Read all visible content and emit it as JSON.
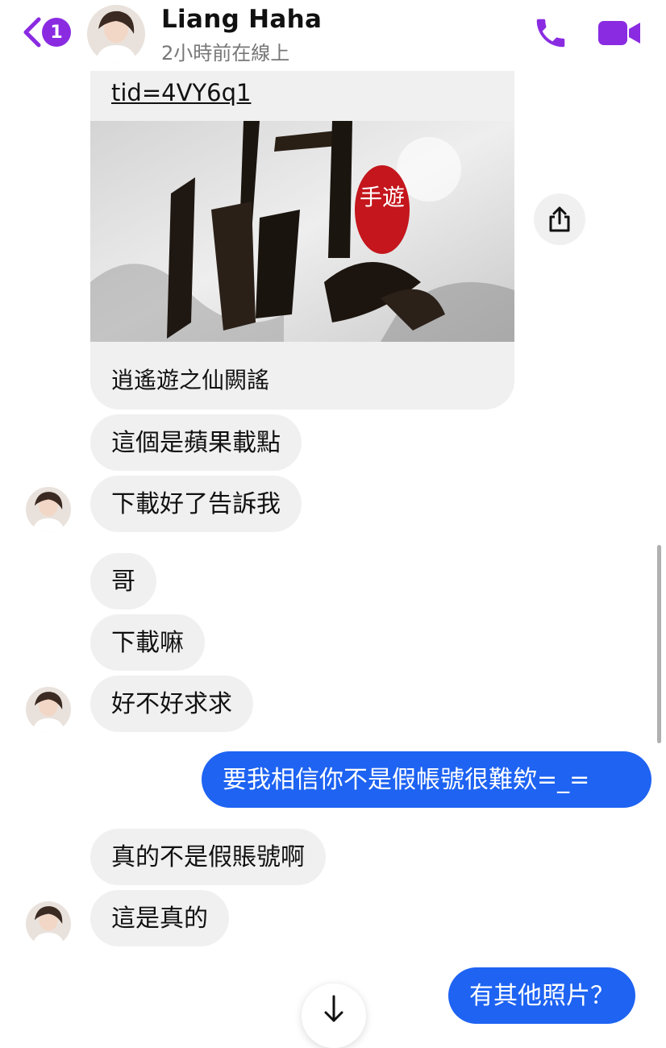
{
  "header": {
    "unread_count": "1",
    "contact_name": "Liang Haha",
    "presence": "2小時前在線上",
    "icons": {
      "back": "chevron-left-icon",
      "call": "phone-icon",
      "video": "video-camera-icon"
    }
  },
  "link_preview": {
    "url_fragment": "tid=4VY6q1",
    "title": "逍遙遊之仙闕謠",
    "image_text": {
      "badge": "手遊"
    }
  },
  "messages": [
    {
      "text": "這個是蘋果載點",
      "from": "them"
    },
    {
      "text": "下載好了告訴我",
      "from": "them"
    },
    {
      "text": "哥",
      "from": "them"
    },
    {
      "text": "下載嘛",
      "from": "them"
    },
    {
      "text": "好不好求求",
      "from": "them"
    },
    {
      "text": "要我相信你不是假帳號很難欸=_=",
      "from": "me"
    },
    {
      "text": "真的不是假賬號啊",
      "from": "them"
    },
    {
      "text": "這是真的",
      "from": "them"
    },
    {
      "text": "有其他照片？",
      "from": "me"
    }
  ],
  "colors": {
    "accent": "#8a2be2",
    "my_bubble": "#1e63f2",
    "their_bubble": "#f0f0f0"
  }
}
